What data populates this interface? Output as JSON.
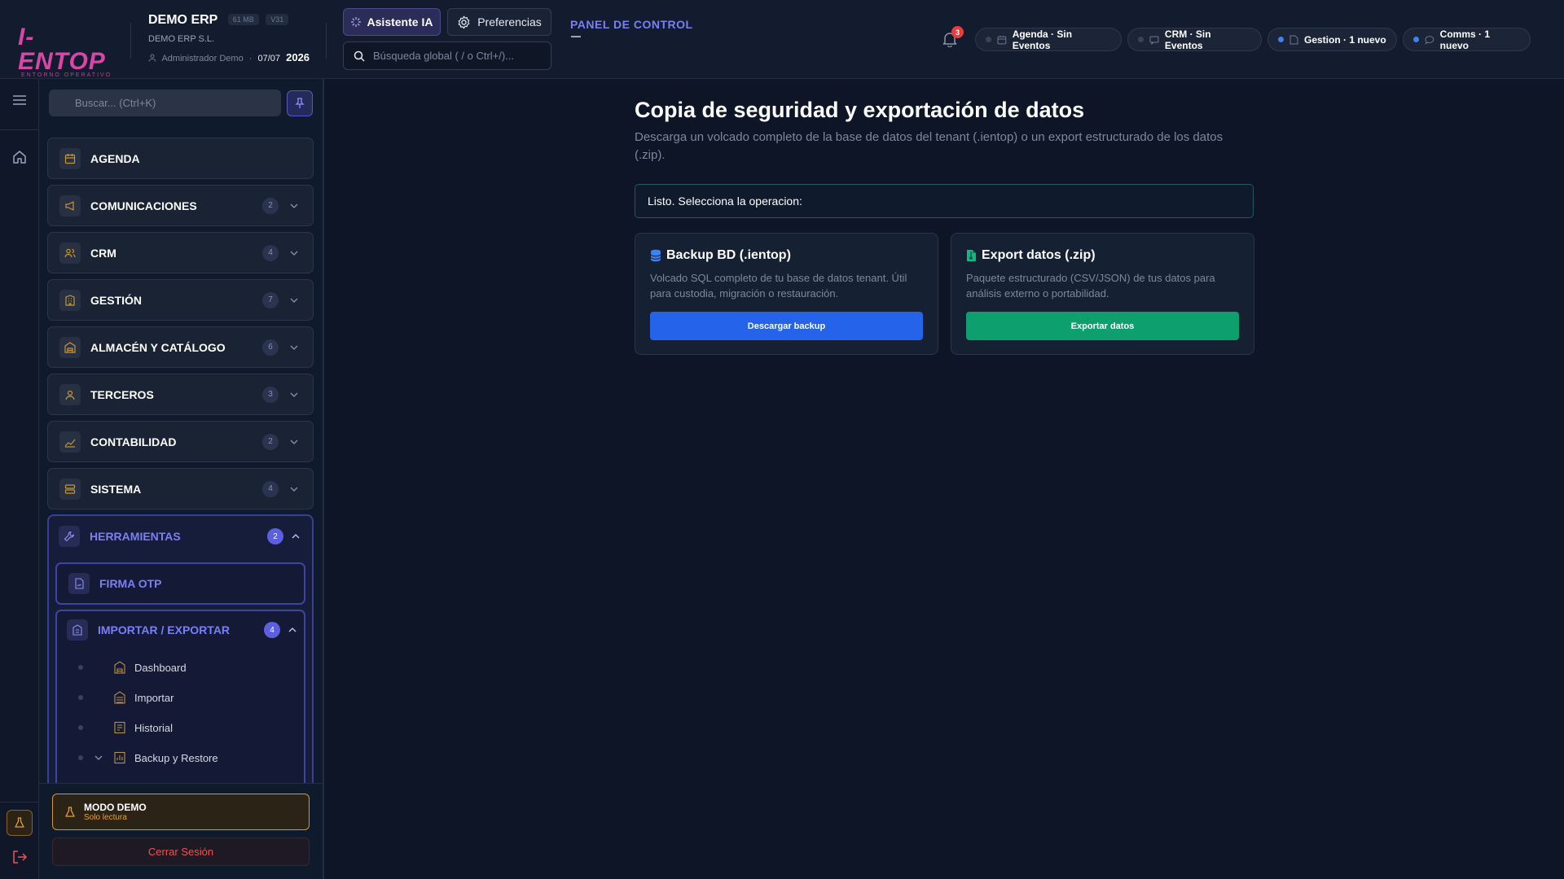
{
  "header": {
    "logo_text": "I-ENTOP",
    "logo_subtitle": "ENTORNO OPERATIVO",
    "company_name": "DEMO ERP",
    "size_badge": "61 MB",
    "version_badge": "V31",
    "company_legal": "DEMO ERP S.L.",
    "user_name": "Administrador Demo",
    "date_short": "07/07",
    "year": "2026",
    "ai_button": "Asistente IA",
    "prefs_button": "Preferencias",
    "global_search_placeholder": "Búsqueda global ( / o Ctrl+/)...",
    "panel_title": "PANEL DE CONTROL",
    "notif_count": "3",
    "status_pills": [
      {
        "label": "Agenda · Sin Eventos",
        "dot": "#3a4358"
      },
      {
        "label": "CRM · Sin Eventos",
        "dot": "#3a4358"
      },
      {
        "label": "Gestion · 1 nuevo",
        "dot": "#3b82f6"
      },
      {
        "label": "Comms · 1 nuevo",
        "dot": "#3b82f6"
      }
    ]
  },
  "sidebar": {
    "search_placeholder": "Buscar... (Ctrl+K)",
    "items": [
      {
        "label": "AGENDA",
        "count": ""
      },
      {
        "label": "COMUNICACIONES",
        "count": "2"
      },
      {
        "label": "CRM",
        "count": "4"
      },
      {
        "label": "GESTIÓN",
        "count": "7"
      },
      {
        "label": "ALMACÉN Y CATÁLOGO",
        "count": "6"
      },
      {
        "label": "TERCEROS",
        "count": "3"
      },
      {
        "label": "CONTABILIDAD",
        "count": "2"
      },
      {
        "label": "SISTEMA",
        "count": "4"
      }
    ],
    "tools": {
      "label": "HERRAMIENTAS",
      "count": "2",
      "firma": "FIRMA OTP",
      "import_export": {
        "label": "IMPORTAR / EXPORTAR",
        "count": "4",
        "children": [
          "Dashboard",
          "Importar",
          "Historial",
          "Backup y Restore"
        ]
      }
    },
    "demo_title": "MODO DEMO",
    "demo_subtitle": "Solo lectura",
    "logout": "Cerrar Sesión"
  },
  "main": {
    "title": "Copia de seguridad y exportación de datos",
    "description": "Descarga un volcado completo de la base de datos del tenant (.ientop) o un export estructurado de los datos (.zip).",
    "status": "Listo. Selecciona la operacion:",
    "cards": [
      {
        "title": "Backup BD (.ientop)",
        "description": "Volcado SQL completo de tu base de datos tenant. Útil para custodia, migración o restauración.",
        "button": "Descargar backup",
        "color": "#2563eb"
      },
      {
        "title": "Export datos (.zip)",
        "description": "Paquete estructurado (CSV/JSON) de tus datos para análisis externo o portabilidad.",
        "button": "Exportar datos",
        "color": "#0e9f6e"
      }
    ]
  },
  "colors": {
    "accent": "#7b7ff6",
    "icon_gold": "#c9962e",
    "backup_icon": "#3b82f6",
    "export_icon": "#10b981"
  }
}
